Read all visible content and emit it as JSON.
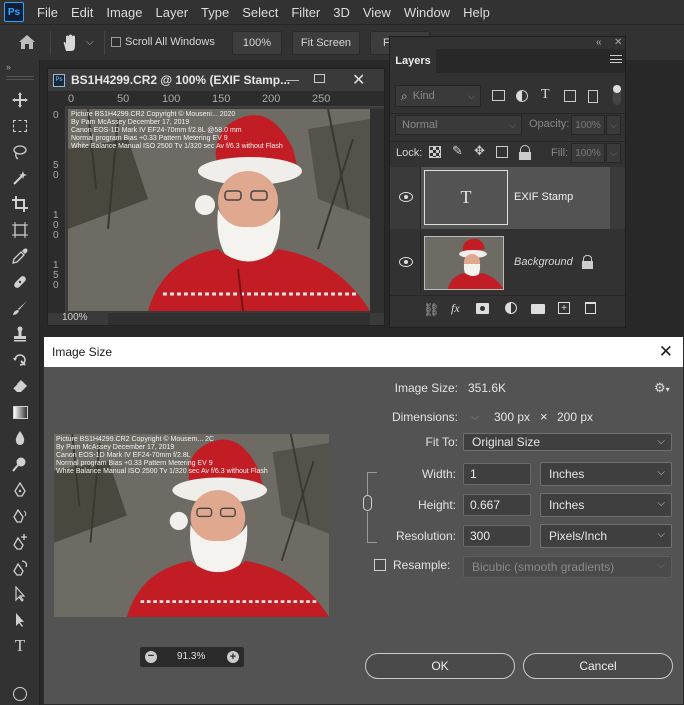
{
  "menu": {
    "items": [
      "File",
      "Edit",
      "Image",
      "Layer",
      "Type",
      "Select",
      "Filter",
      "3D",
      "View",
      "Window",
      "Help"
    ],
    "logo": "Ps"
  },
  "options_bar": {
    "scroll_all_windows": "Scroll All Windows",
    "zoom_pct": "100%",
    "fit_screen": "Fit Screen",
    "fill_screen": "Fi"
  },
  "document": {
    "title": "BS1H4299.CR2 @ 100% (EXIF Stamp...",
    "zoom_status": "100%",
    "ruler_top": [
      "0",
      "50",
      "100",
      "150",
      "200",
      "250"
    ],
    "ruler_left": [
      "0",
      "5\n0",
      "1\n0\n0",
      "1\n5\n0"
    ]
  },
  "exif_lines": [
    "Picture  BS1H4299.CR2  Copyright © Mouseni... 2020",
    "By Pam McAssey  December 17, 2019",
    "Canon EOS-1D Mark IV  EF24-70mm f/2.8L  @58.0 mm",
    "Normal program  Bias +0.33  Pattern Metering  EV 9",
    "White Balance Manual  ISO 2500  Tv 1/320 sec  Av f/6.3  without Flash"
  ],
  "exif_lines_dialog": [
    "Picture  BS1H4299.CR2  Copyright © Mousem... 2C",
    "By Pam McAssey  December 17, 2019",
    "Canon EOS-1D Mark IV  EF24-70mm f/2.8L",
    "Normal program  Bias +0.33  Pattern Metering  EV 9",
    "White Balance Manual  ISO 2500  Tv 1/320 sec  Av f/6.3  without Flash"
  ],
  "layers_panel": {
    "title": "Layers",
    "kind_label": "Kind",
    "blend_mode": "Normal",
    "opacity_label": "Opacity:",
    "opacity_value": "100%",
    "lock_label": "Lock:",
    "fill_label": "Fill:",
    "fill_value": "100%",
    "layers": [
      {
        "name": "EXIF Stamp",
        "type_glyph": "T"
      },
      {
        "name": "Background"
      }
    ]
  },
  "dialog": {
    "title": "Image Size",
    "image_size_label": "Image Size:",
    "image_size_value": "351.6K",
    "dimensions_label": "Dimensions:",
    "dim_w": "300 px",
    "dim_x": "×",
    "dim_h": "200 px",
    "fit_to_label": "Fit To:",
    "fit_to_value": "Original Size",
    "width_label": "Width:",
    "width_value": "1",
    "width_unit": "Inches",
    "height_label": "Height:",
    "height_value": "0.667",
    "height_unit": "Inches",
    "resolution_label": "Resolution:",
    "resolution_value": "300",
    "resolution_unit": "Pixels/Inch",
    "resample_label": "Resample:",
    "resample_value": "Bicubic (smooth gradients)",
    "preview_zoom": "91.3%",
    "ok": "OK",
    "cancel": "Cancel"
  },
  "colors": {
    "accent": "#31a8ff",
    "santa_red": "#c21d24",
    "panel": "#323232",
    "dialog": "#535353"
  }
}
